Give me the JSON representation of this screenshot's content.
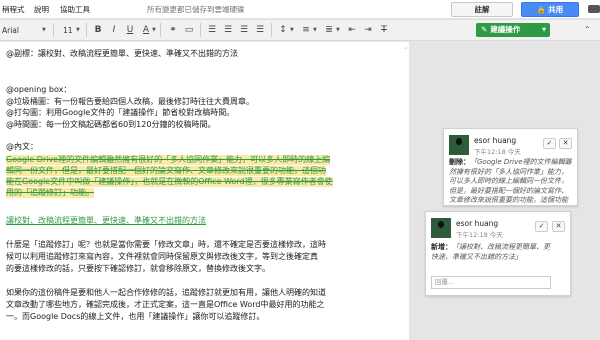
{
  "menubar": {
    "items": [
      "稍程式",
      "說明",
      "協助工具"
    ],
    "saved_status": "所有變更都已儲存到雲端硬碟",
    "comment_button": "註解",
    "share_button": "共用"
  },
  "toolbar": {
    "font": "Arial",
    "size": "11",
    "suggest_button": "建議操作",
    "icons": [
      "bold-icon",
      "italic-icon",
      "underline-icon",
      "text-color-icon",
      "link-icon",
      "comment-icon",
      "align-left-icon",
      "align-center-icon",
      "align-right-icon",
      "align-justify-icon",
      "line-spacing-icon",
      "numbered-list-icon",
      "bulleted-list-icon",
      "outdent-icon",
      "indent-icon",
      "clear-format-icon"
    ]
  },
  "document": {
    "lines": [
      "@副標：讓校對、改稿流程更簡單、更快速、準確又不出錯的方法",
      "",
      "@opening box：",
      "@垃圾桶圖：有一份報告要給四個人改稿，最後修訂時往往大費周章。",
      "@打勾圖：利用Google文件的「建議操作」節省校對改稿時間。",
      "@時間圖：每一份文稿起碼都省60到120分鐘的校稿時間。",
      "",
      "@內文："
    ],
    "strike_lines": [
      "Google Drive裡的文件編輯雖然擁有很好的「多人協同作業」能力，可以多人即時的線上編",
      "輯同一份文件，但是，最好要搭配一個好的論文寫作、文章修改來說很重要的功能，這個功",
      "能在Google文件中叫做「建議操作」，也就是在微軟的Office Word裡，很多專業寫作者會使",
      "用的「追蹤修訂」功能。"
    ],
    "inserted_line": "讓校對、改稿流程更簡單、更快速、準確又不出錯的方法",
    "para2": [
      "什麼是「追蹤修訂」呢？也就是當你需要「修改文章」時，還不確定是否要這樣修改，這時",
      "候可以利用追蹤修訂來寫內容，文件裡就會同時保留原文與修改後文字，等到之後確定真",
      "的要這樣修改的話，只要按下確認修訂，就會移除原文，替換修改後文字。"
    ],
    "para3": [
      "如果你的這份稿件是要和他人一起合作修修的話，追蹤修訂就更加有用，讓他人明確的知道",
      "文章改動了哪些地方，確認完成後，才正式定案，這一直是Office Word中最好用的功能之",
      "一。而Google Docs的線上文件，也用「建議操作」讓你可以追蹤修訂。"
    ]
  },
  "comments": [
    {
      "name": "esor huang",
      "time": "下午12:18 今天",
      "label": "刪除：",
      "text_lines": [
        "「Google Drive裡的文件編輯雖",
        "然擁有很好的「多人協同作業」能力，",
        "可以多人即時的線上編輯同一份文件，",
        "但是，最好要搭配一個好的論文寫作、",
        "文章修改來說很重要的功能，這個功能",
        "在Google文件中叫做「..."
      ]
    },
    {
      "name": "esor huang",
      "time": "下午12:18 今天",
      "label": "新增：",
      "text_lines": [
        "「讓校對、改稿流程更簡單、更",
        "快速、準確又不出錯的方法」"
      ],
      "reply_placeholder": "回覆..."
    }
  ]
}
